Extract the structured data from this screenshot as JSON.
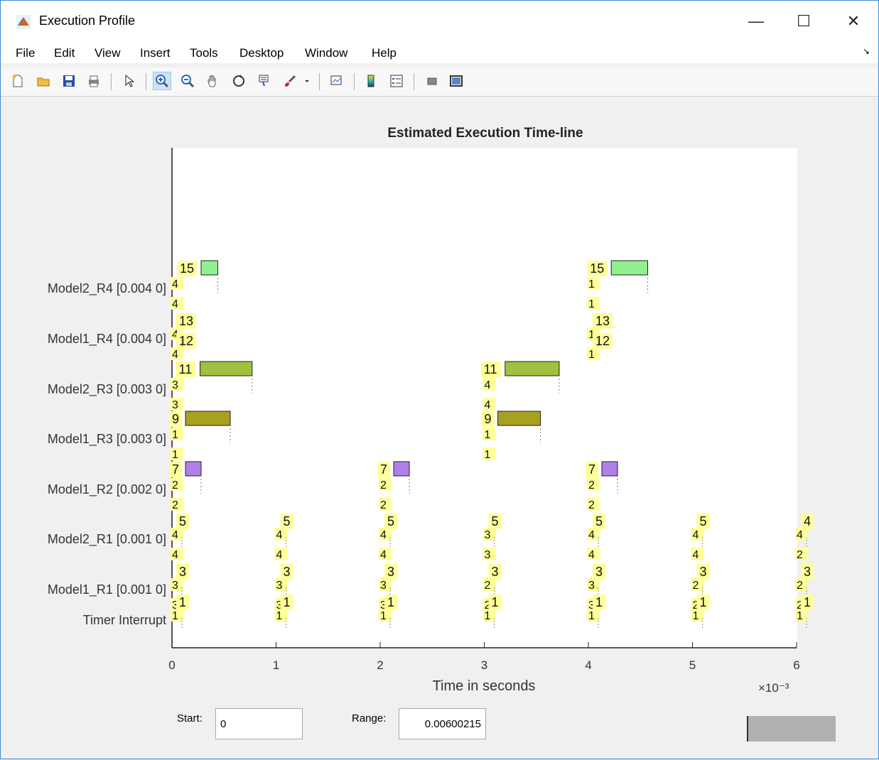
{
  "window": {
    "title": "Execution Profile",
    "controls": {
      "minimize": "—",
      "maximize": "☐",
      "close": "✕"
    }
  },
  "menu": [
    "File",
    "Edit",
    "View",
    "Insert",
    "Tools",
    "Desktop",
    "Window",
    "Help"
  ],
  "toolbar": [
    {
      "icon": "new-figure-icon"
    },
    {
      "icon": "open-file-icon"
    },
    {
      "icon": "save-icon"
    },
    {
      "icon": "print-icon"
    },
    {
      "icon": "pointer-icon"
    },
    {
      "icon": "zoom-in-icon",
      "active": true
    },
    {
      "icon": "zoom-out-icon"
    },
    {
      "icon": "pan-icon"
    },
    {
      "icon": "rotate-3d-icon"
    },
    {
      "icon": "data-cursor-icon"
    },
    {
      "icon": "brush-icon"
    },
    {
      "icon": "link-plot-icon"
    },
    {
      "icon": "colorbar-icon"
    },
    {
      "icon": "legend-icon"
    },
    {
      "icon": "hide-plot-tools-icon"
    },
    {
      "icon": "show-plot-tools-icon"
    }
  ],
  "chart_data": {
    "type": "timeline",
    "title": "Estimated Execution Time-line",
    "xlabel": "Time in seconds",
    "x_exponent": "×10⁻³",
    "xlim": [
      0,
      6
    ],
    "xticks": [
      "0",
      "1",
      "2",
      "3",
      "4",
      "5",
      "6"
    ],
    "rows": [
      "Model2_R4 [0.004 0]",
      "Model1_R4 [0.004 0]",
      "Model2_R3 [0.003 0]",
      "Model1_R3 [0.003 0]",
      "Model1_R2 [0.002 0]",
      "Model2_R1 [0.001 0]",
      "Model1_R1 [0.001 0]",
      "Timer Interrupt"
    ],
    "colors": {
      "Model2_R4": "#90f090",
      "Model2_R3": "#a0c040",
      "Model1_R3": "#a8a020",
      "Model1_R2": "#b080e8",
      "label_bg": "#ffff99"
    },
    "bars": [
      {
        "row": 0,
        "start": 0.28,
        "end": 0.44,
        "color": "Model2_R4",
        "label": "15"
      },
      {
        "row": 0,
        "start": 4.22,
        "end": 4.57,
        "color": "Model2_R4",
        "label": "15"
      },
      {
        "row": 2,
        "start": 0.27,
        "end": 0.77,
        "color": "Model2_R3",
        "label": "11"
      },
      {
        "row": 2,
        "start": 3.2,
        "end": 3.72,
        "color": "Model2_R3",
        "label": "11"
      },
      {
        "row": 3,
        "start": 0.13,
        "end": 0.56,
        "color": "Model1_R3",
        "label": "9"
      },
      {
        "row": 3,
        "start": 3.13,
        "end": 3.54,
        "color": "Model1_R3",
        "label": "9"
      },
      {
        "row": 4,
        "start": 0.13,
        "end": 0.28,
        "color": "Model1_R2",
        "label": "7"
      },
      {
        "row": 4,
        "start": 2.13,
        "end": 2.28,
        "color": "Model1_R2",
        "label": "7"
      },
      {
        "row": 4,
        "start": 4.13,
        "end": 4.28,
        "color": "Model1_R2",
        "label": "7"
      }
    ],
    "markers": [
      {
        "row": 1,
        "x": 0.0,
        "label": "13"
      },
      {
        "row": 1,
        "x": 0.0,
        "label": "12"
      },
      {
        "row": 1,
        "x": 4.0,
        "label": "13"
      },
      {
        "row": 1,
        "x": 4.0,
        "label": "12"
      },
      {
        "row": 5,
        "x": 0,
        "label": "5"
      },
      {
        "row": 5,
        "x": 1,
        "label": "5"
      },
      {
        "row": 5,
        "x": 2,
        "label": "5"
      },
      {
        "row": 5,
        "x": 3,
        "label": "5"
      },
      {
        "row": 5,
        "x": 4,
        "label": "5"
      },
      {
        "row": 5,
        "x": 5,
        "label": "5"
      },
      {
        "row": 5,
        "x": 6,
        "label": "4"
      },
      {
        "row": 6,
        "x": 0,
        "label": "3"
      },
      {
        "row": 6,
        "x": 1,
        "label": "3"
      },
      {
        "row": 6,
        "x": 2,
        "label": "3"
      },
      {
        "row": 6,
        "x": 3,
        "label": "3"
      },
      {
        "row": 6,
        "x": 4,
        "label": "3"
      },
      {
        "row": 6,
        "x": 5,
        "label": "3"
      },
      {
        "row": 6,
        "x": 6,
        "label": "3"
      },
      {
        "row": 7,
        "x": 0,
        "label": "1"
      },
      {
        "row": 7,
        "x": 1,
        "label": "1"
      },
      {
        "row": 7,
        "x": 2,
        "label": "1"
      },
      {
        "row": 7,
        "x": 3,
        "label": "1"
      },
      {
        "row": 7,
        "x": 4,
        "label": "1"
      },
      {
        "row": 7,
        "x": 5,
        "label": "1"
      },
      {
        "row": 7,
        "x": 6,
        "label": "1"
      }
    ],
    "small_labels": [
      {
        "row": 0,
        "x": 0.0,
        "texts": [
          "4",
          "4"
        ]
      },
      {
        "row": 0,
        "x": 4.0,
        "texts": [
          "1",
          "1"
        ]
      },
      {
        "row": 1,
        "x": 0.0,
        "texts": [
          "4",
          "4"
        ]
      },
      {
        "row": 1,
        "x": 4.0,
        "texts": [
          "1",
          "1"
        ]
      },
      {
        "row": 2,
        "x": 0.0,
        "texts": [
          "3",
          "3"
        ]
      },
      {
        "row": 2,
        "x": 3.0,
        "texts": [
          "4",
          "4"
        ]
      },
      {
        "row": 3,
        "x": 0.0,
        "texts": [
          "1",
          "1"
        ]
      },
      {
        "row": 3,
        "x": 3.0,
        "texts": [
          "1",
          "1"
        ]
      },
      {
        "row": 4,
        "x": 0.0,
        "texts": [
          "2",
          "2"
        ]
      },
      {
        "row": 4,
        "x": 2.0,
        "texts": [
          "2",
          "2"
        ]
      },
      {
        "row": 4,
        "x": 4.0,
        "texts": [
          "2",
          "2"
        ]
      },
      {
        "row": 5,
        "x": 0,
        "texts": [
          "4",
          "4"
        ]
      },
      {
        "row": 5,
        "x": 1,
        "texts": [
          "4",
          "4"
        ]
      },
      {
        "row": 5,
        "x": 2,
        "texts": [
          "4",
          "4"
        ]
      },
      {
        "row": 5,
        "x": 3,
        "texts": [
          "3",
          "3"
        ]
      },
      {
        "row": 5,
        "x": 4,
        "texts": [
          "4",
          "4"
        ]
      },
      {
        "row": 5,
        "x": 5,
        "texts": [
          "4",
          "4"
        ]
      },
      {
        "row": 5,
        "x": 6,
        "texts": [
          "4",
          "2"
        ]
      },
      {
        "row": 6,
        "x": 0,
        "texts": [
          "3",
          "3"
        ]
      },
      {
        "row": 6,
        "x": 1,
        "texts": [
          "3",
          "3"
        ]
      },
      {
        "row": 6,
        "x": 2,
        "texts": [
          "3",
          "3"
        ]
      },
      {
        "row": 6,
        "x": 3,
        "texts": [
          "2",
          "2"
        ]
      },
      {
        "row": 6,
        "x": 4,
        "texts": [
          "3",
          "3"
        ]
      },
      {
        "row": 6,
        "x": 5,
        "texts": [
          "2",
          "2"
        ]
      },
      {
        "row": 6,
        "x": 6,
        "texts": [
          "2",
          "2"
        ]
      },
      {
        "row": 7,
        "x": 0,
        "texts": [
          "1"
        ]
      },
      {
        "row": 7,
        "x": 1,
        "texts": [
          "1"
        ]
      },
      {
        "row": 7,
        "x": 2,
        "texts": [
          "1"
        ]
      },
      {
        "row": 7,
        "x": 3,
        "texts": [
          "1"
        ]
      },
      {
        "row": 7,
        "x": 4,
        "texts": [
          "1"
        ]
      },
      {
        "row": 7,
        "x": 5,
        "texts": [
          "1"
        ]
      },
      {
        "row": 7,
        "x": 6,
        "texts": [
          "1"
        ]
      }
    ]
  },
  "controls": {
    "start_label": "Start:",
    "start_value": "0",
    "range_label": "Range:",
    "range_value": "0.00600215"
  }
}
